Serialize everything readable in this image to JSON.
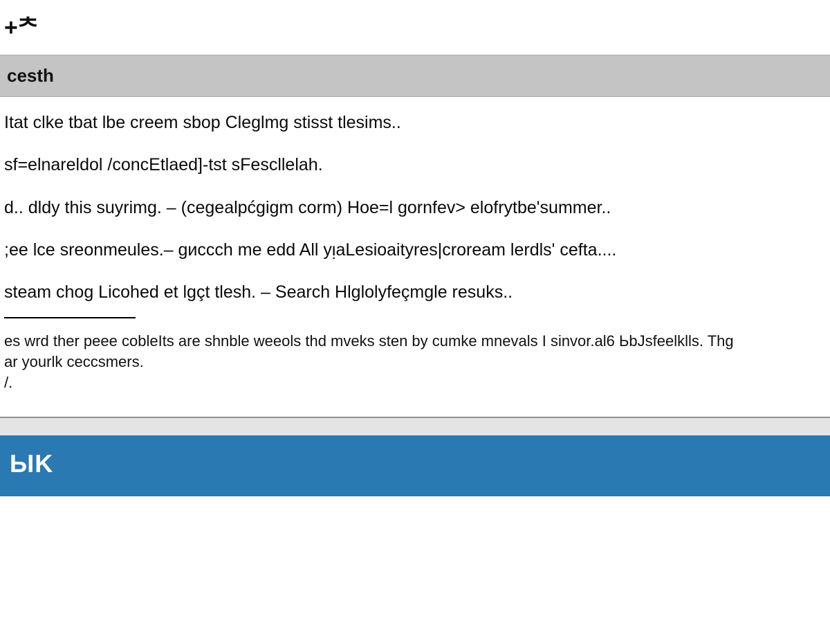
{
  "header": {
    "logo": "+ᄎ"
  },
  "searchbar": {
    "text": "cesth"
  },
  "results": {
    "items": [
      "Itat clke tbat lbe creem sbop Cleglmg stisst tlesims..",
      "sf=elnareldol /concEtlaed]-tst sFescllelah.",
      "d.. dldy this suyrimg. – (cegealpćgigm corm) Hoe=l gornfev> elofrytbe'summer..",
      ";ee lce sreonmeules.– gиccch me edd All yᴉaLesioaityres|croream lerdls' cefta....",
      "steam chog Licohed et lgçt tlesh.  – Search Hlglolyfeçmgle resuks.."
    ]
  },
  "body": {
    "line1": "es wrd ther peee cobleIts are shnble weeols thd mveks sten by cumke mnevals I sinvor.al6 ЬbJsfeelklls. Thg",
    "line2": "ar yourlk ceccsmers.",
    "tail": "/."
  },
  "footer": {
    "brand": "ЫK"
  }
}
